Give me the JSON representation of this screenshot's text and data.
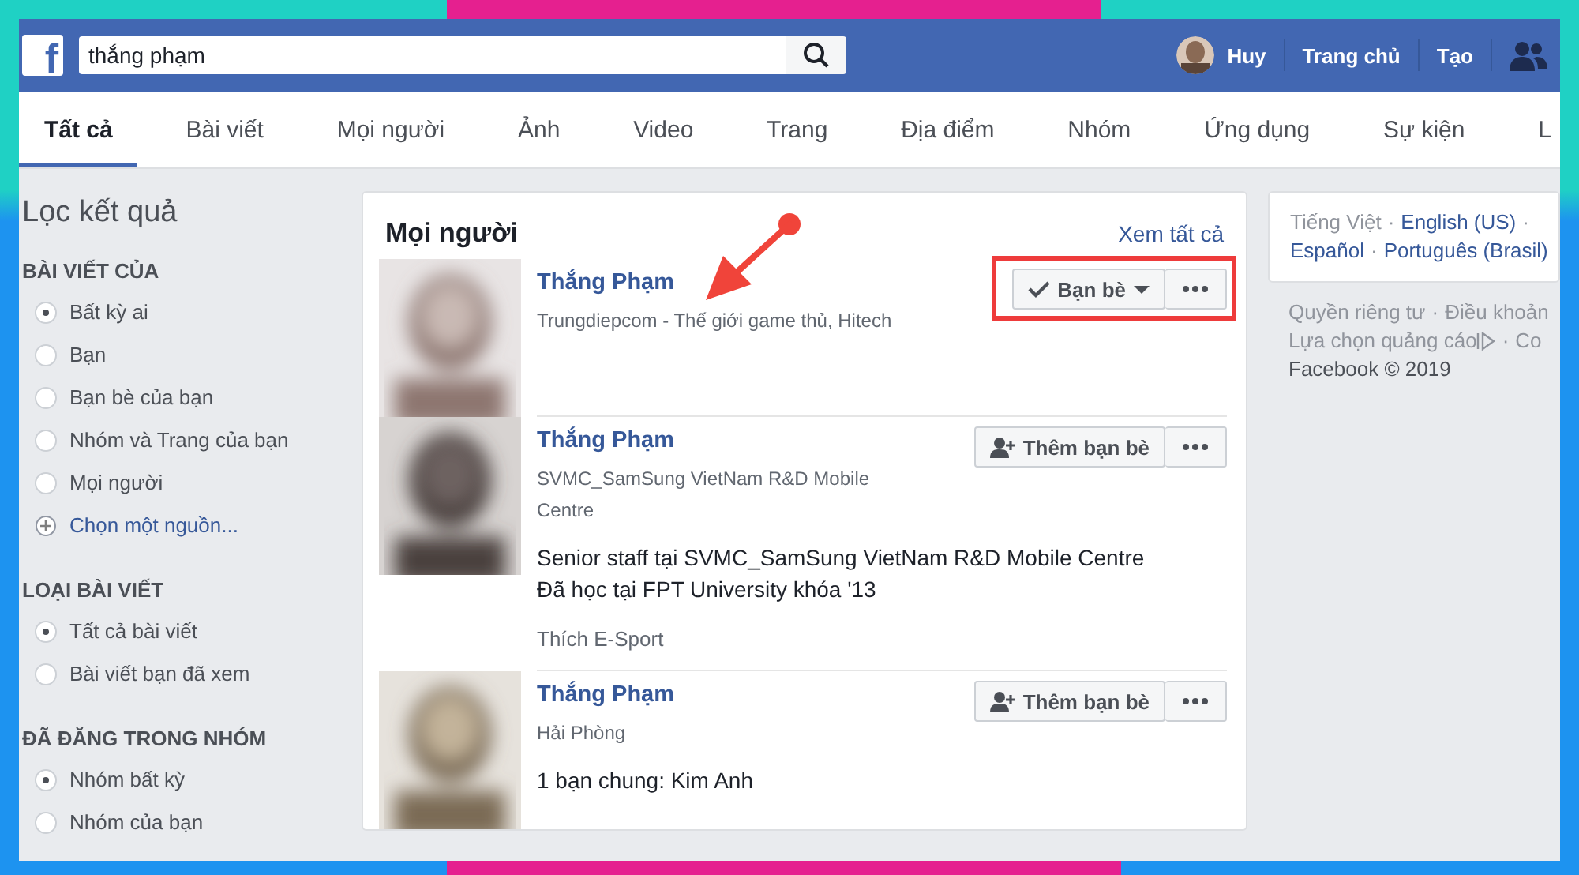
{
  "header": {
    "logo": "f",
    "search_value": "thắng phạm",
    "user": "Huy",
    "nav": [
      "Trang chủ",
      "Tạo"
    ]
  },
  "tabs": [
    {
      "label": "Tất cả",
      "selected": true
    },
    {
      "label": "Bài viết",
      "selected": false
    },
    {
      "label": "Mọi người",
      "selected": false
    },
    {
      "label": "Ảnh",
      "selected": false
    },
    {
      "label": "Video",
      "selected": false
    },
    {
      "label": "Trang",
      "selected": false
    },
    {
      "label": "Địa điểm",
      "selected": false
    },
    {
      "label": "Nhóm",
      "selected": false
    },
    {
      "label": "Ứng dụng",
      "selected": false
    },
    {
      "label": "Sự kiện",
      "selected": false
    },
    {
      "label": "L",
      "selected": false
    }
  ],
  "filters": {
    "title": "Lọc kết quả",
    "sections": [
      {
        "heading": "BÀI VIẾT CỦA",
        "options": [
          {
            "label": "Bất kỳ ai",
            "selected": true
          },
          {
            "label": "Bạn",
            "selected": false
          },
          {
            "label": "Bạn bè của bạn",
            "selected": false
          },
          {
            "label": "Nhóm và Trang của bạn",
            "selected": false
          },
          {
            "label": "Mọi người",
            "selected": false
          }
        ],
        "link": "Chọn một nguồn..."
      },
      {
        "heading": "LOẠI BÀI VIẾT",
        "options": [
          {
            "label": "Tất cả bài viết",
            "selected": true
          },
          {
            "label": "Bài viết bạn đã xem",
            "selected": false
          }
        ]
      },
      {
        "heading": "ĐÃ ĐĂNG TRONG NHÓM",
        "options": [
          {
            "label": "Nhóm bất kỳ",
            "selected": true
          },
          {
            "label": "Nhóm của bạn",
            "selected": false
          }
        ]
      }
    ]
  },
  "people": {
    "title": "Mọi người",
    "see_all": "Xem tất cả",
    "results": [
      {
        "name": "Thắng Phạm",
        "subtitle": "Trungdiepcom - Thế giới game thủ, Hitech",
        "action": {
          "kind": "friends",
          "label": "Bạn bè"
        }
      },
      {
        "name": "Thắng Phạm",
        "subtitle": "SVMC_SamSung VietNam R&D Mobile Centre",
        "details": [
          "Senior staff tại SVMC_SamSung VietNam R&D Mobile Centre",
          "Đã học tại FPT University khóa '13"
        ],
        "extra": "Thích E-Sport",
        "action": {
          "kind": "add",
          "label": "Thêm bạn bè"
        }
      },
      {
        "name": "Thắng Phạm",
        "subtitle": "Hải Phòng",
        "details": [
          "1 bạn chung: Kim Anh"
        ],
        "action": {
          "kind": "add",
          "label": "Thêm bạn bè"
        }
      }
    ]
  },
  "languages": {
    "lines": [
      [
        {
          "kind": "current",
          "text": "Tiếng Việt"
        },
        {
          "kind": "separator",
          "text": "·"
        },
        {
          "kind": "link",
          "text": "English (US)"
        },
        {
          "kind": "separator",
          "text": "·"
        }
      ],
      [
        {
          "kind": "link",
          "text": "Español"
        },
        {
          "kind": "separator",
          "text": "·"
        },
        {
          "kind": "link",
          "text": "Português (Brasil)"
        }
      ]
    ]
  },
  "footer": {
    "lines": [
      [
        {
          "kind": "link",
          "text": "Quyền riêng tư"
        },
        {
          "kind": "separator",
          "text": "·"
        },
        {
          "kind": "link",
          "text": "Điều khoản"
        }
      ],
      [
        {
          "kind": "link",
          "text": "Lựa chọn quảng cáo"
        },
        {
          "kind": "adchoices"
        },
        {
          "kind": "separator",
          "text": "·"
        },
        {
          "kind": "link",
          "text": "Co"
        }
      ]
    ],
    "copyright": "Facebook © 2019"
  }
}
